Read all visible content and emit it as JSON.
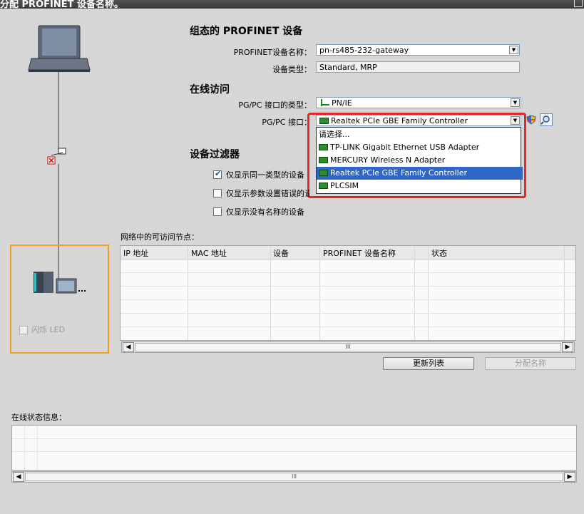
{
  "window": {
    "title": "分配 PROFINET 设备名称。"
  },
  "configured": {
    "heading": "组态的 PROFINET 设备",
    "name_label": "PROFINET设备名称：",
    "name_value": "pn-rs485-232-gateway",
    "type_label": "设备类型：",
    "type_value": "Standard, MRP"
  },
  "online_access": {
    "heading": "在线访问",
    "iface_type_label": "PG/PC 接口的类型：",
    "iface_type_value": "PN/IE",
    "iface_label": "PG/PC 接口：",
    "iface_value": "Realtek PCIe GBE Family Controller",
    "dropdown_items": [
      "请选择...",
      "TP-LINK Gigabit Ethernet USB Adapter",
      "MERCURY Wireless N Adapter",
      "Realtek PCIe GBE Family Controller",
      "PLCSIM"
    ],
    "selected_index": 3,
    "highlight_color": "#3066c6"
  },
  "filter": {
    "heading": "设备过滤器",
    "options": [
      {
        "label": "仅显示同一类型的设备",
        "checked": true
      },
      {
        "label": "仅显示参数设置错误的设备",
        "checked": false
      },
      {
        "label": "仅显示没有名称的设备",
        "checked": false
      }
    ]
  },
  "nodes": {
    "title": "网络中的可访问节点：",
    "columns": [
      "IP 地址",
      "MAC 地址",
      "设备",
      "PROFINET 设备名称",
      "状态"
    ],
    "scroll_thumb": "III"
  },
  "buttons": {
    "refresh": "更新列表",
    "assign": "分配名称"
  },
  "diagram": {
    "flash_led": "闪烁 LED",
    "accent": "#f0a020"
  },
  "status": {
    "title": "在线状态信息：",
    "scroll_thumb": "III"
  }
}
